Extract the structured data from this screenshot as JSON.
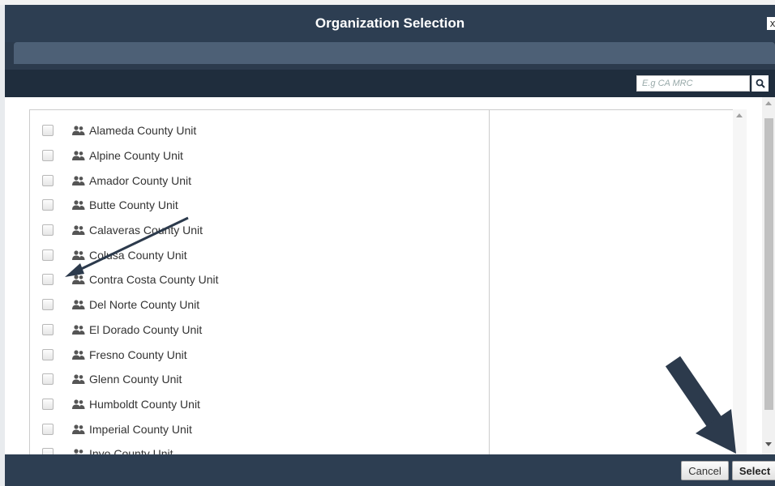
{
  "dialog": {
    "title": "Organization Selection",
    "close_label": "x"
  },
  "search": {
    "placeholder": "E.g CA MRC"
  },
  "organizations": [
    "Alameda County Unit",
    "Alpine County Unit",
    "Amador County Unit",
    "Butte County Unit",
    "Calaveras County Unit",
    "Colusa County Unit",
    "Contra Costa County Unit",
    "Del Norte County Unit",
    "El Dorado County Unit",
    "Fresno County Unit",
    "Glenn County Unit",
    "Humboldt County Unit",
    "Imperial County Unit",
    "Inyo County Unit"
  ],
  "footer": {
    "cancel_label": "Cancel",
    "select_label": "Select"
  },
  "colors": {
    "header": "#2d3e52",
    "tabbar": "#4d6076",
    "annotation_arrow": "#2c3a4c"
  },
  "icons": {
    "org_item": "group-icon",
    "search": "search-icon"
  }
}
